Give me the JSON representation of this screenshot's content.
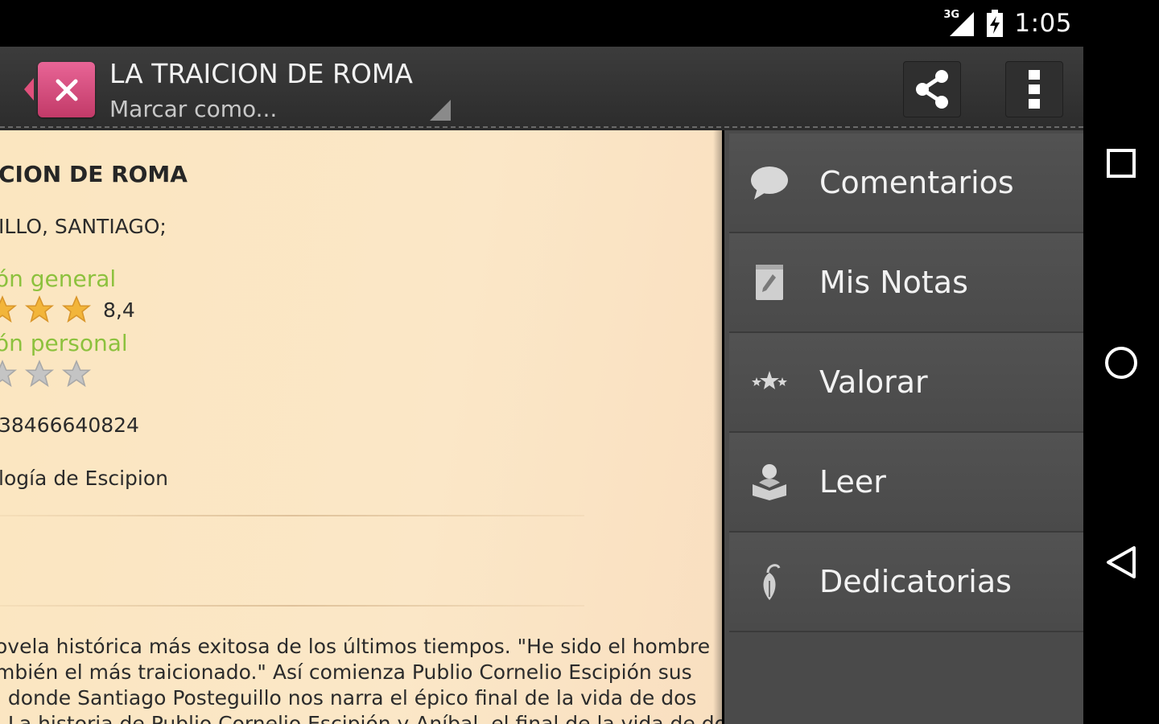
{
  "status_bar": {
    "time": "1:05",
    "network": "3G"
  },
  "action_bar": {
    "title": "LA TRAICION DE ROMA",
    "subtitle": "Marcar como...",
    "share_icon": "share-icon",
    "overflow_icon": "overflow-menu-icon"
  },
  "book": {
    "title": "LA TRAICION DE ROMA",
    "title_visible": "CION DE ROMA",
    "author_visible": "ILLO, SANTIAGO;",
    "general_rating_label": "ón general",
    "general_rating_value": "8,4",
    "personal_rating_label": "ón personal",
    "isbn_visible": "38466640824",
    "series_visible": "logía de Escipion",
    "synopsis_lines": [
      "ovela histórica más exitosa de los últimos tiempos.  \"He sido el hombre",
      "mbién el más traicionado.\" Así comienza Publio Cornelio Escipión sus",
      ", donde  Santiago Posteguillo  nos narra el épico final de la vida de dos",
      ". La historia de Publio Cornelio Escipión y Aníbal, el final de la vida de dos"
    ]
  },
  "drawer": {
    "items": [
      {
        "label": "Comentarios",
        "icon": "comment-bubble-icon"
      },
      {
        "label": "Mis Notas",
        "icon": "notepad-icon"
      },
      {
        "label": "Valorar",
        "icon": "rate-stars-icon"
      },
      {
        "label": "Leer",
        "icon": "reader-icon"
      },
      {
        "label": "Dedicatorias",
        "icon": "fountain-pen-icon"
      }
    ]
  },
  "colors": {
    "accent_pink": "#d94a7a",
    "rating_green": "#8cc13d",
    "star_gold": "#f2b53a",
    "star_gray": "#b8b8b8",
    "page_bg": "#fbe6c0",
    "drawer_bg": "#4a4a4a"
  }
}
